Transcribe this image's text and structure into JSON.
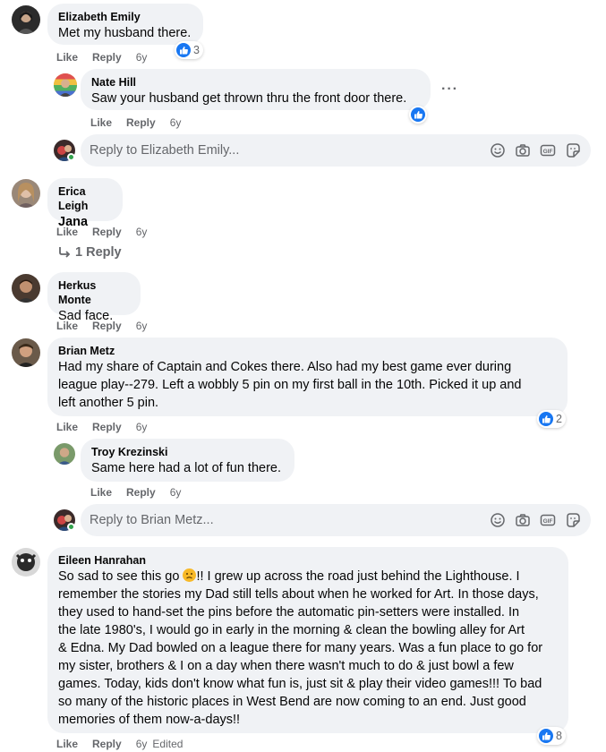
{
  "comments": [
    {
      "author": "Elizabeth Emily",
      "text": "Met my husband there.",
      "like_label": "Like",
      "reply_label": "Reply",
      "time": "6y",
      "reaction_count": "3",
      "replies": [
        {
          "author": "Nate Hill",
          "text": "Saw your husband get thrown thru the front door there.",
          "like_label": "Like",
          "reply_label": "Reply",
          "time": "6y"
        }
      ],
      "reply_placeholder": "Reply to Elizabeth Emily..."
    },
    {
      "author": "Erica Leigh",
      "text": "Jana",
      "like_label": "Like",
      "reply_label": "Reply",
      "time": "6y",
      "view_replies": "1 Reply"
    },
    {
      "author": "Herkus Monte",
      "text": "Sad face.",
      "like_label": "Like",
      "reply_label": "Reply",
      "time": "6y"
    },
    {
      "author": "Brian Metz",
      "text_lines": [
        "Had my share of Captain and Cokes there. Also had my best game ever during",
        "league play--279. Left a wobbly 5 pin on my first ball in the 10th. Picked it up and",
        "left another 5 pin."
      ],
      "like_label": "Like",
      "reply_label": "Reply",
      "time": "6y",
      "reaction_count": "2",
      "replies": [
        {
          "author": "Troy Krezinski",
          "text": "Same here had a lot of fun there.",
          "like_label": "Like",
          "reply_label": "Reply",
          "time": "6y"
        }
      ],
      "reply_placeholder": "Reply to Brian Metz..."
    },
    {
      "author": "Eileen Hanrahan",
      "text_first": "So sad to see this go ",
      "text_after_emoji": "!! I grew up across the road just behind the Lighthouse. I",
      "text_lines": [
        "remember the stories my Dad still tells about when he worked for Art. In those days,",
        "they used to hand-set the pins before the automatic pin-setters were installed. In",
        "the late 1980's, I would go in early in the morning & clean the bowling alley for Art",
        "& Edna. My Dad bowled on a league there for many years. Was a fun place to go for",
        "my sister, brothers & I on a day when there wasn't much to do & just bowl a few",
        "games. Today, kids don't know what fun is, just sit & play their video games!!! To bad",
        "so many of the historic places in West Bend are now coming to an end. Just good",
        "memories of them now-a-days!!"
      ],
      "like_label": "Like",
      "reply_label": "Reply",
      "time": "6y",
      "edited": "Edited",
      "reaction_count": "8"
    }
  ],
  "colors": {
    "bubble": "#f0f2f5",
    "meta": "#65676b",
    "like_blue": "#1877f2",
    "online": "#31a24c"
  },
  "icons": [
    "like-icon",
    "more-icon",
    "reply-arrow-icon",
    "emoji-icon",
    "camera-icon",
    "gif-icon",
    "sticker-icon"
  ]
}
